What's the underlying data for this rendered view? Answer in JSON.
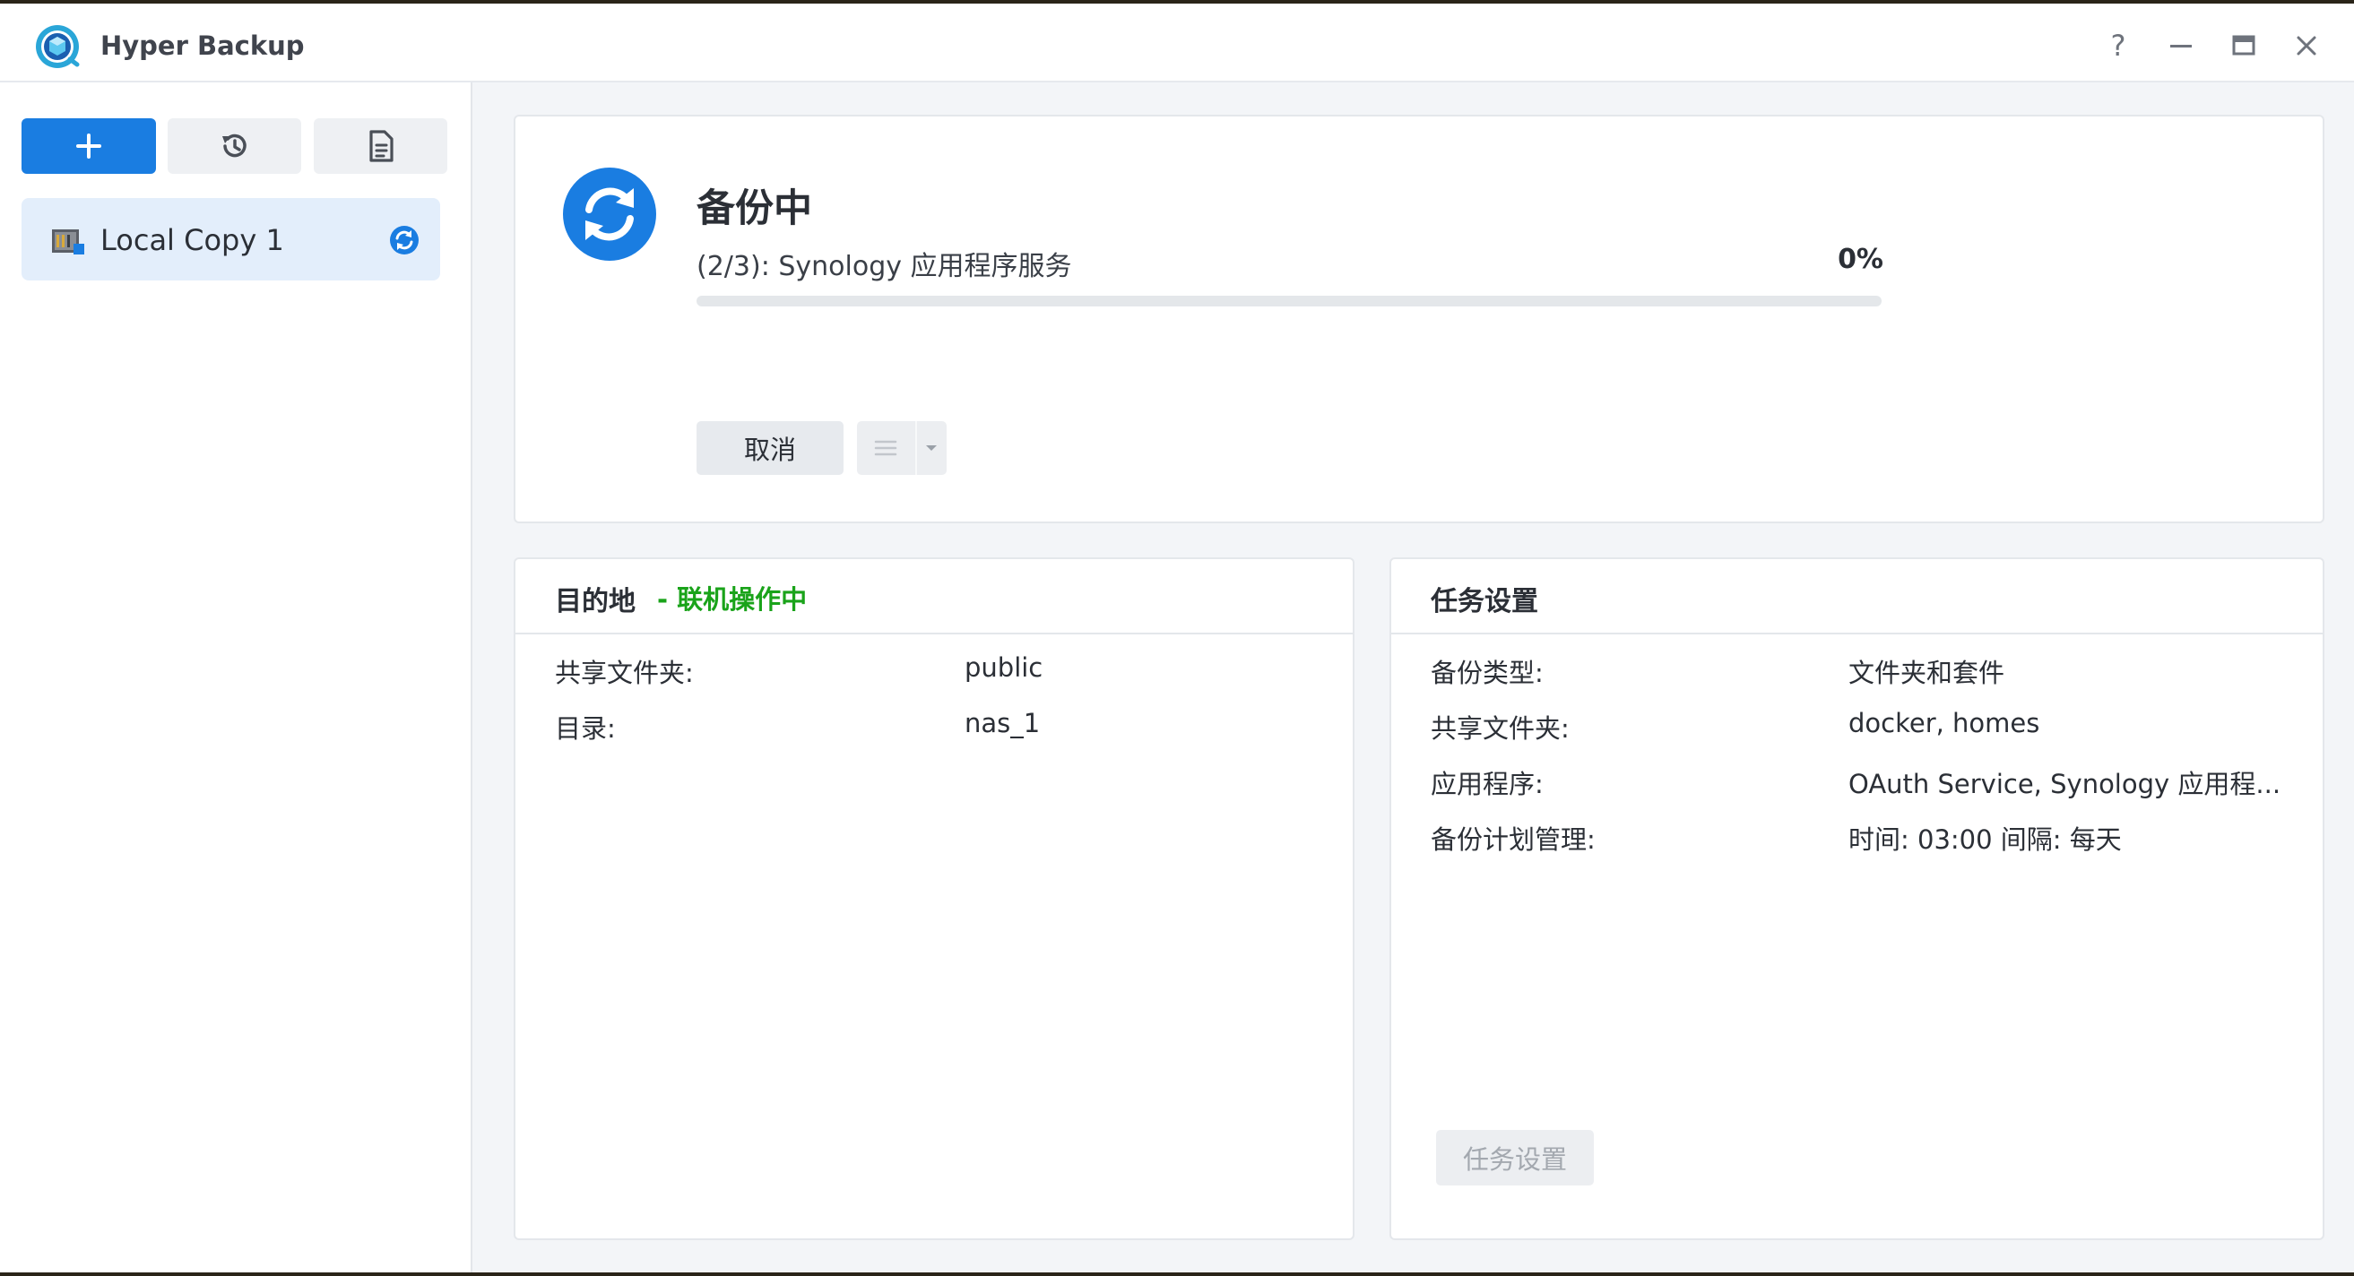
{
  "window": {
    "title": "Hyper Backup",
    "controls": {
      "help": "?",
      "minimize_icon": "minimize-icon",
      "maximize_icon": "maximize-icon",
      "close_icon": "close-icon"
    }
  },
  "toolbar": {
    "add_icon": "plus-icon",
    "history_icon": "history-icon",
    "log_icon": "document-icon"
  },
  "sidebar": {
    "items": [
      {
        "label": "Local Copy 1",
        "icon": "local-copy-icon",
        "status_icon": "syncing-icon",
        "selected": true
      }
    ]
  },
  "status": {
    "title": "备份中",
    "step": "(2/3): Synology 应用程序服务",
    "percent_label": "0%",
    "progress": 0,
    "cancel_label": "取消",
    "menu_icon": "list-icon",
    "menu_dropdown_icon": "caret-down-icon"
  },
  "destination": {
    "title": "目的地",
    "state": "- 联机操作中",
    "rows": [
      {
        "key": "共享文件夹:",
        "value": "public"
      },
      {
        "key": "目录:",
        "value": "nas_1"
      }
    ]
  },
  "task_settings": {
    "title": "任务设置",
    "rows": [
      {
        "key": "备份类型:",
        "value": "文件夹和套件"
      },
      {
        "key": "共享文件夹:",
        "value": "docker, homes"
      },
      {
        "key": "应用程序:",
        "value": "OAuth Service, Synology 应用程..."
      },
      {
        "key": "备份计划管理:",
        "value": "时间: 03:00 间隔: 每天"
      }
    ],
    "button_label": "任务设置"
  },
  "colors": {
    "accent": "#1a7de1",
    "online_status": "#1aa31a",
    "selected_item_bg": "#e3eefb"
  }
}
